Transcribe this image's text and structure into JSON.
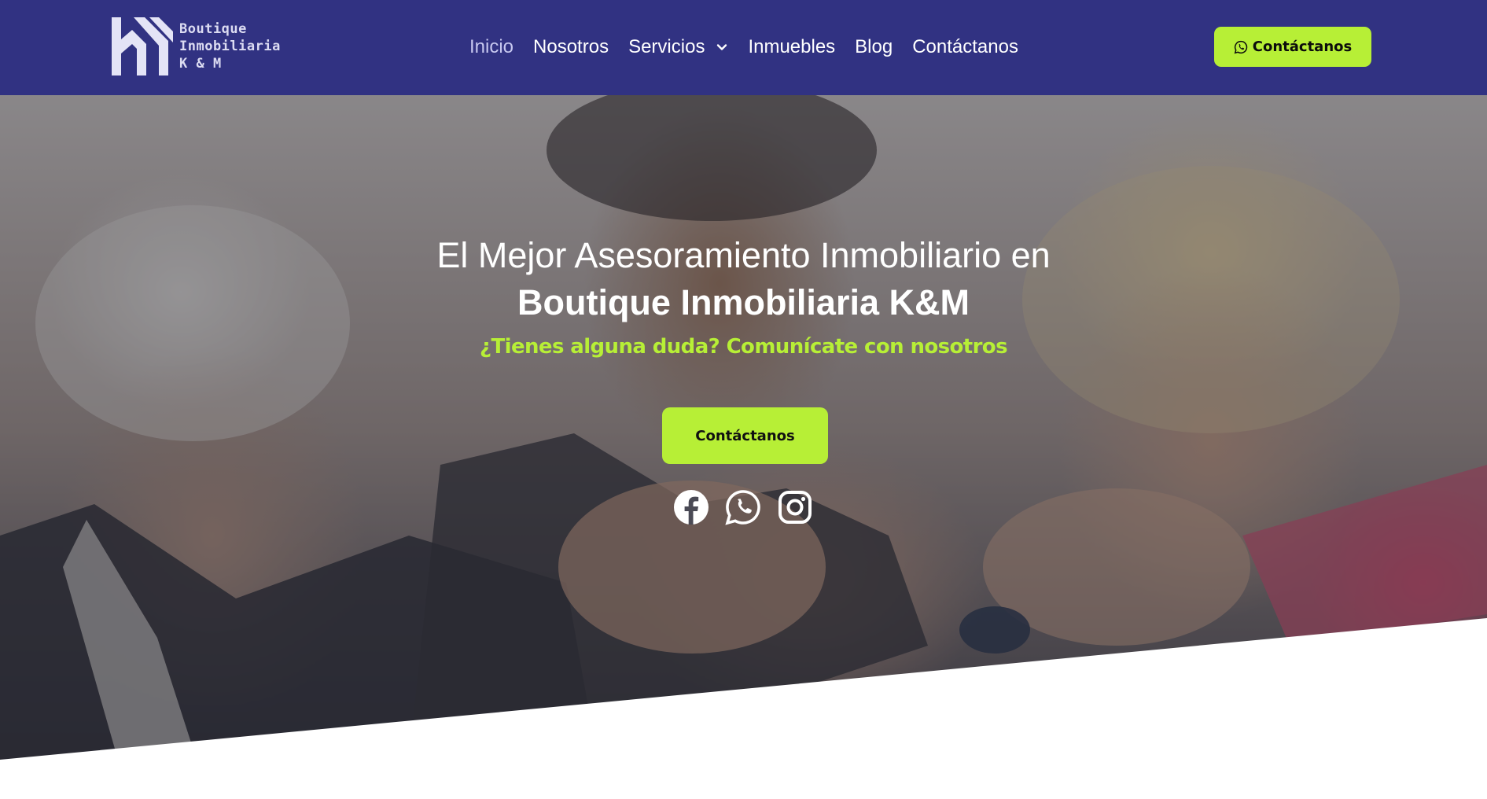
{
  "brand": {
    "logo_lines": [
      "Boutique",
      "Inmobiliaria",
      "K & M"
    ]
  },
  "nav": {
    "items": [
      {
        "label": "Inicio",
        "active": true
      },
      {
        "label": "Nosotros",
        "active": false
      },
      {
        "label": "Servicios",
        "active": false,
        "has_dropdown": true
      },
      {
        "label": "Inmuebles",
        "active": false
      },
      {
        "label": "Blog",
        "active": false
      },
      {
        "label": "Contáctanos",
        "active": false
      }
    ],
    "dropdown_icon": "chevron-down-icon"
  },
  "header_cta": {
    "label": "Contáctanos",
    "icon": "whatsapp-icon"
  },
  "hero": {
    "headline_light": "El Mejor Asesoramiento Inmobiliario en",
    "headline_bold": "Boutique Inmobiliaria K&M",
    "subheadline": "¿Tienes alguna duda? Comunícate con nosotros",
    "cta_label": "Contáctanos",
    "socials": [
      "facebook-icon",
      "whatsapp-icon",
      "instagram-icon"
    ]
  },
  "colors": {
    "header_bg": "#313282",
    "accent": "#b7ef36",
    "nav_active": "#c7c8f0",
    "text_light": "#ffffff"
  }
}
